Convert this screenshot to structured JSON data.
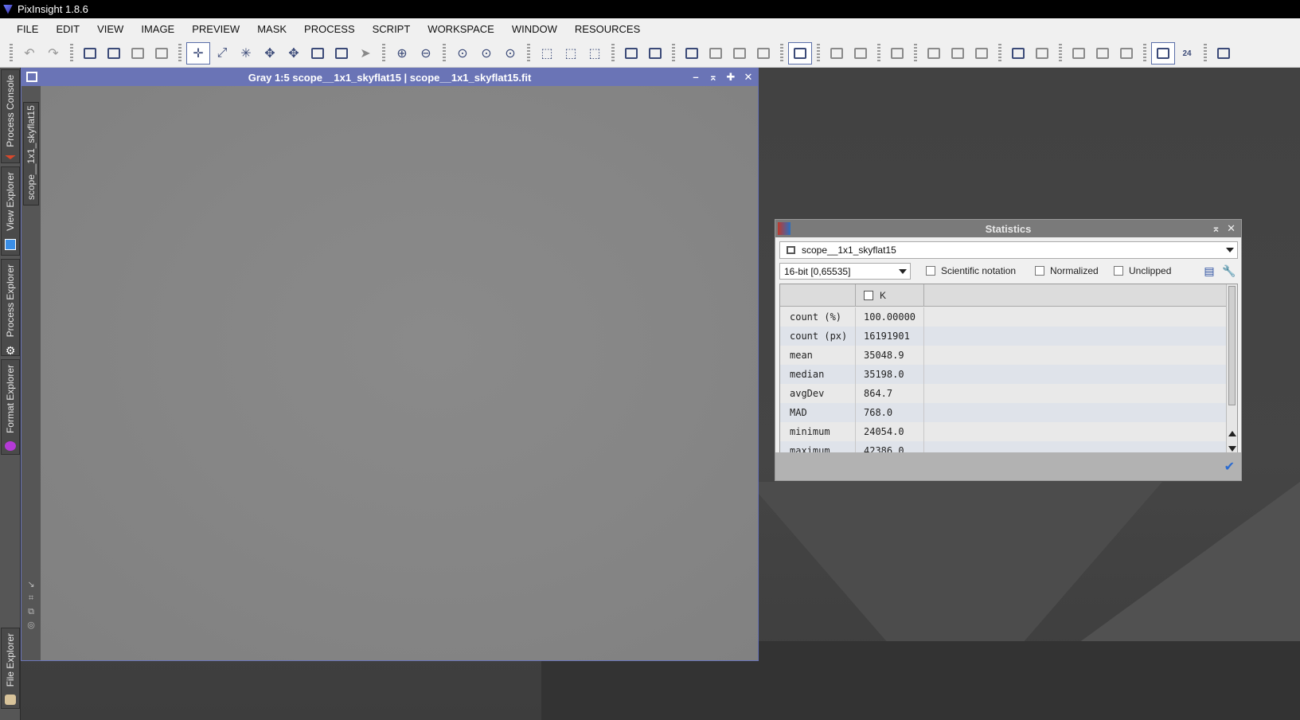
{
  "app": {
    "title": "PixInsight 1.8.6"
  },
  "menu": [
    "FILE",
    "EDIT",
    "VIEW",
    "IMAGE",
    "PREVIEW",
    "MASK",
    "PROCESS",
    "SCRIPT",
    "WORKSPACE",
    "WINDOW",
    "RESOURCES"
  ],
  "left_dock": {
    "tabs": [
      {
        "label": "Process Console",
        "icon": "process-console-icon"
      },
      {
        "label": "View Explorer",
        "icon": "view-explorer-icon"
      },
      {
        "label": "Process Explorer",
        "icon": "gear-icon"
      },
      {
        "label": "Format Explorer",
        "icon": "format-explorer-icon"
      },
      {
        "label": "File Explorer",
        "icon": "file-explorer-icon"
      }
    ]
  },
  "image_window": {
    "title": "Gray 1:5 scope__1x1_skyflat15 | scope__1x1_skyflat15.fit",
    "tab_label": "scope__1x1_skyflat15"
  },
  "statistics": {
    "title": "Statistics",
    "view": "scope__1x1_skyflat15",
    "range": "16-bit [0,65535]",
    "options": {
      "scientific": "Scientific notation",
      "normalized": "Normalized",
      "unclipped": "Unclipped"
    },
    "channel": "K",
    "rows": [
      {
        "name": "count (%)",
        "value": "100.00000"
      },
      {
        "name": "count (px)",
        "value": "16191901"
      },
      {
        "name": "mean",
        "value": "35048.9"
      },
      {
        "name": "median",
        "value": "35198.0"
      },
      {
        "name": "avgDev",
        "value": "864.7"
      },
      {
        "name": "MAD",
        "value": "768.0"
      },
      {
        "name": "minimum",
        "value": "24054.0"
      },
      {
        "name": "maximum",
        "value": "42386.0"
      }
    ]
  },
  "colors": {
    "window_active": "#6a74b6",
    "toolbar_icon": "#3b4a78",
    "accent_check": "#2a6bd1"
  }
}
